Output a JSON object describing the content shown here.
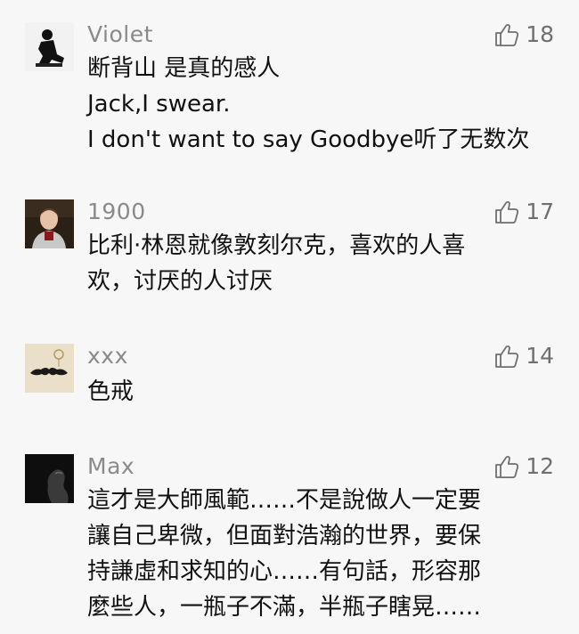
{
  "icons": {
    "like": "thumbs-up-outline-icon"
  },
  "colors": {
    "background": "#f7f7f7",
    "username": "#8a8a8a",
    "text": "#111111",
    "like_count": "#6f6f6f"
  },
  "comments": [
    {
      "username": "Violet",
      "likes": "18",
      "lines": [
        "断背山 是真的感人",
        "Jack,I swear.",
        "I don't want to say Goodbye听了无数次"
      ]
    },
    {
      "username": "1900",
      "likes": "17",
      "lines": [
        "比利·林恩就像敦刻尔克，喜欢的人喜",
        "欢，讨厌的人讨厌"
      ]
    },
    {
      "username": "xxx",
      "likes": "14",
      "lines": [
        "色戒"
      ]
    },
    {
      "username": "Max",
      "likes": "12",
      "lines": [
        "這才是大師風範……不是說做人一定要",
        "讓自己卑微，但面對浩瀚的世界，要保",
        "持謙虛和求知的心……有句話，形容那",
        "麼些人，一瓶子不滿，半瓶子瞎晃……"
      ]
    }
  ]
}
